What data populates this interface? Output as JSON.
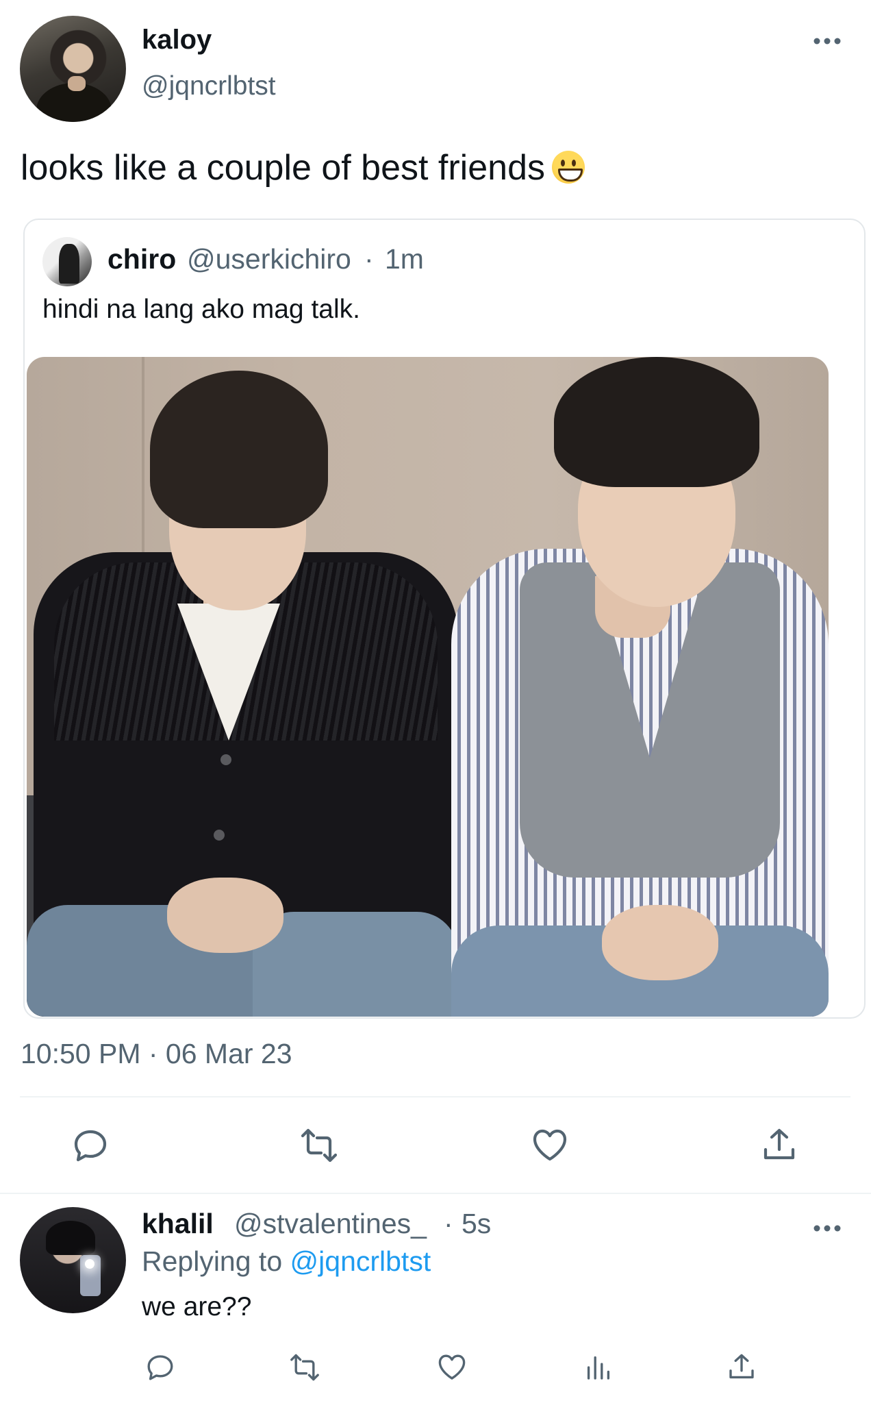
{
  "main_tweet": {
    "display_name": "kaloy",
    "handle": "@jqncrlbtst",
    "text": "looks like a couple of best friends",
    "emoji_icon": "grinning-face-emoji",
    "more_icon": "more-horizontal-icon",
    "timestamp": "10:50 PM · 06 Mar 23"
  },
  "quoted_tweet": {
    "display_name": "chiro",
    "handle": "@userkichiro",
    "separator": "·",
    "time_ago": "1m",
    "text": "hindi na lang ako mag talk."
  },
  "actions": {
    "icons": [
      "reply-icon",
      "retweet-icon",
      "like-icon",
      "share-icon"
    ]
  },
  "reply_tweet": {
    "display_name": "khalil",
    "handle": "@stvalentines_",
    "separator": "·",
    "time_ago": "5s",
    "replying_prefix": "Replying to",
    "replying_handle": "@jqncrlbtst",
    "text": "we are??",
    "icons": [
      "reply-icon",
      "retweet-icon",
      "like-icon",
      "views-icon",
      "share-icon"
    ]
  },
  "colors": {
    "text_primary": "#0f1419",
    "text_secondary": "#536471",
    "link": "#1d9bf0",
    "divider": "#eff3f4"
  }
}
